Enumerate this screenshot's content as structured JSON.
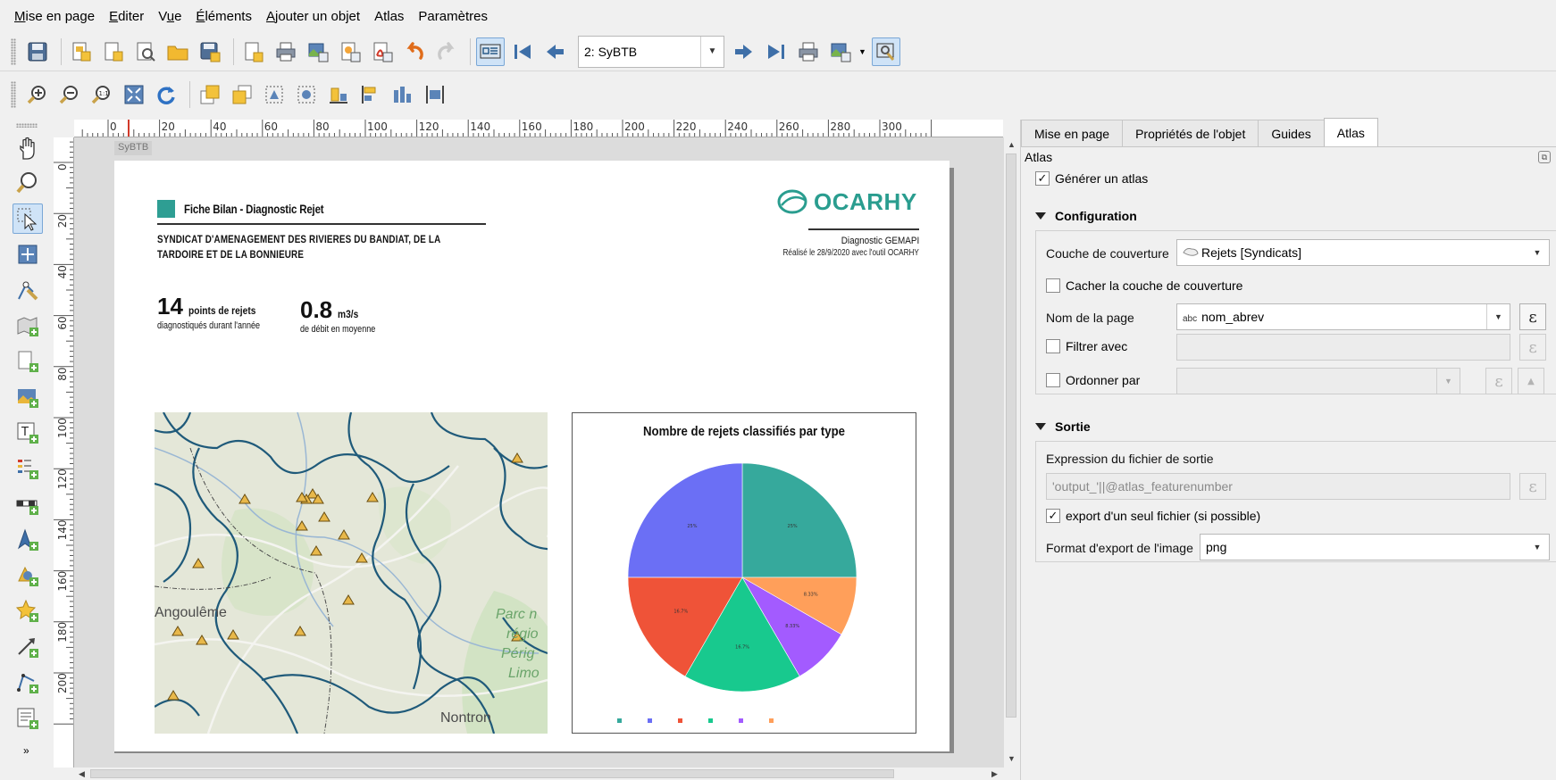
{
  "menubar": {
    "items": [
      {
        "acc": "M",
        "rest": "ise en page"
      },
      {
        "acc": "E",
        "rest": "diter"
      },
      {
        "acc": "",
        "pre": "V",
        "acc2": "u",
        "rest": "e"
      },
      {
        "acc": "É",
        "rest": "léments"
      },
      {
        "acc": "A",
        "rest": "jouter un objet"
      },
      {
        "acc": "",
        "rest": "Atlas"
      },
      {
        "acc": "",
        "rest": "Paramètres"
      }
    ]
  },
  "toolbar": {
    "page_select_value": "2: SyBTB"
  },
  "canvas": {
    "page_label": "SyBTB",
    "ruler_h": [
      "0",
      "20",
      "40",
      "60",
      "80",
      "100",
      "120",
      "140",
      "160",
      "180",
      "200",
      "220",
      "240",
      "260",
      "280",
      "300"
    ],
    "ruler_v": [
      "0",
      "20",
      "40",
      "60",
      "80",
      "100",
      "120",
      "140",
      "160",
      "180",
      "200"
    ]
  },
  "layout_page": {
    "title": "Fiche Bilan - Diagnostic Rejet",
    "syndicat": "SYNDICAT D'AMENAGEMENT DES RIVIERES DU BANDIAT, DE LA TARDOIRE ET DE LA BONNIEURE",
    "logo_text": "OCARHY",
    "diag_label": "Diagnostic GEMAPI",
    "realise_label": "Réalisé le 28/9/2020 avec l'outil OCARHY",
    "stat1": {
      "value": "14",
      "unit": "points de rejets",
      "sub": "diagnostiqués durant l'année"
    },
    "stat2": {
      "value": "0.8",
      "unit": "m3/s",
      "sub": "de débit en moyenne"
    },
    "map_labels": {
      "angouleme": "Angoulême",
      "parc1": "Parc n",
      "parc2": "régio",
      "parc3": "Périg",
      "parc4": "Limo",
      "nontron": "Nontron"
    },
    "chart_title": "Nombre de rejets classifiés par type"
  },
  "chart_data": {
    "type": "pie",
    "title": "Nombre de rejets classifiés par type",
    "categories": [
      "",
      "",
      "",
      "",
      "",
      ""
    ],
    "values": [
      25,
      8.33,
      8.33,
      16.7,
      16.7,
      25
    ],
    "slice_labels": [
      "25%",
      "8.33%",
      "8.33%",
      "16.7%",
      "16.7%",
      "25%"
    ],
    "colors": [
      "#36a99c",
      "#ff9f5a",
      "#a35bff",
      "#18c98e",
      "#ef5338",
      "#6b6ff5"
    ]
  },
  "right_panel": {
    "tabs": [
      "Mise en page",
      "Propriétés de l'objet",
      "Guides",
      "Atlas"
    ],
    "active_tab": "Atlas",
    "title": "Atlas",
    "generate_atlas": "Générer un atlas",
    "config_header": "Configuration",
    "coverage_label": "Couche de couverture",
    "coverage_value": "Rejets [Syndicats]",
    "hide_coverage": "Cacher la couche de couverture",
    "page_name_label": "Nom de la page",
    "page_name_value": "nom_abrev",
    "abc": "abc",
    "filter_label": "Filtrer avec",
    "sort_label": "Ordonner par",
    "output_header": "Sortie",
    "output_expr_label": "Expression du fichier de sortie",
    "output_expr_value": "'output_'||@atlas_featurenumber",
    "single_file": "export d'un seul fichier (si possible)",
    "image_format_label": "Format d'export de l'image",
    "image_format_value": "png",
    "epsilon": "ε"
  },
  "icons": {
    "accent": "#2e9e93"
  }
}
